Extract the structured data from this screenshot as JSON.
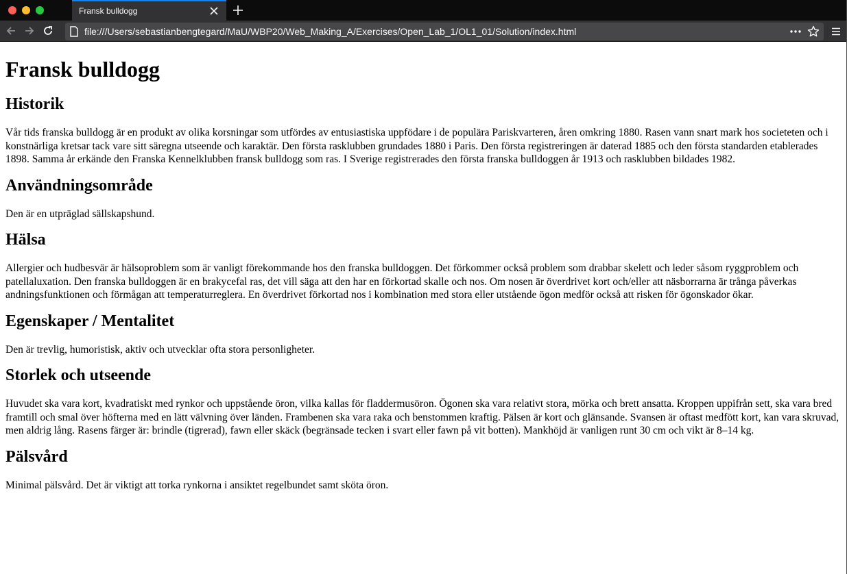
{
  "browser": {
    "tab_title": "Fransk bulldogg",
    "url": "file:///Users/sebastianbengtegard/MaU/WBP20/Web_Making_A/Exercises/Open_Lab_1/OL1_01/Solution/index.html",
    "icons": [
      "close-icon",
      "plus-icon",
      "back-icon",
      "forward-icon",
      "reload-icon",
      "page-icon",
      "more-icon",
      "star-icon",
      "hamburger-menu-icon"
    ]
  },
  "page": {
    "title": "Fransk bulldogg",
    "sections": [
      {
        "heading": "Historik",
        "text": "Vår tids franska bulldogg är en produkt av olika korsningar som utfördes av entusiastiska uppfödare i de populära Pariskvarteren, åren omkring 1880. Rasen vann snart mark hos societeten och i konstnärliga kretsar tack vare sitt säregna utseende och karaktär. Den första rasklubben grundades 1880 i Paris. Den första registreringen är daterad 1885 och den första standarden etablerades 1898. Samma år erkände den Franska Kennelklubben fransk bulldogg som ras. I Sverige registrerades den första franska bulldoggen år 1913 och rasklubben bildades 1982."
      },
      {
        "heading": "Användningsområde",
        "text": "Den är en utpräglad sällskapshund."
      },
      {
        "heading": "Hälsa",
        "text": "Allergier och hudbesvär är hälsoproblem som är vanligt förekommande hos den franska bulldoggen. Det förkommer också problem som drabbar skelett och leder såsom ryggproblem och patellaluxation. Den franska bulldoggen är en brakycefal ras, det vill säga att den har en förkortad skalle och nos. Om nosen är överdrivet kort och/eller att näsborrarna är trånga påverkas andningsfunktionen och förmågan att temperaturreglera. En överdrivet förkortad nos i kombination med stora eller utstående ögon medför också att risken för ögonskador ökar."
      },
      {
        "heading": "Egenskaper / Mentalitet",
        "text": "Den är trevlig, humoristisk, aktiv och utvecklar ofta stora personligheter."
      },
      {
        "heading": "Storlek och utseende",
        "text": "Huvudet ska vara kort, kvadratiskt med rynkor och uppstående öron, vilka kallas för fladdermusöron. Ögonen ska vara relativt stora, mörka och brett ansatta. Kroppen uppifrån sett, ska vara bred framtill och smal över höfterna med en lätt välvning över länden. Frambenen ska vara raka och benstommen kraftig. Pälsen är kort och glänsande. Svansen är oftast medfött kort, kan vara skruvad, men aldrig lång. Rasens färger är: brindle (tigrerad), fawn eller skäck (begränsade tecken i svart eller fawn på vit botten). Mankhöjd är vanligen runt 30 cm och vikt är 8–14 kg."
      },
      {
        "heading": "Pälsvård",
        "text": "Minimal pälsvård. Det är viktigt att torka rynkorna i ansiktet regelbundet samt sköta öron."
      }
    ]
  }
}
